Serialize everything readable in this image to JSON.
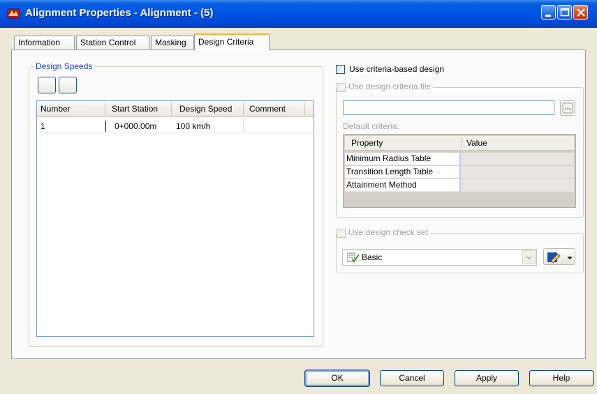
{
  "window": {
    "title": "Alignment Properties - Alignment - (5)",
    "titlebar_color": "#0055e5"
  },
  "tabs": [
    {
      "label": "Information"
    },
    {
      "label": "Station Control"
    },
    {
      "label": "Masking"
    },
    {
      "label": "Design Criteria",
      "active": true
    }
  ],
  "design_speeds": {
    "group_title": "Design Speeds",
    "columns": [
      "Number",
      "Start Station",
      "Design Speed",
      "Comment"
    ],
    "rows": [
      {
        "number": "1",
        "start_station": "0+000.00m",
        "design_speed": "100 km/h",
        "comment": ""
      }
    ]
  },
  "criteria": {
    "use_criteria_based_design_label": "Use criteria-based design",
    "use_criteria_based_design_checked": false,
    "use_design_criteria_file_label": "Use design criteria file",
    "file_path": "",
    "ellipsis_label": "...",
    "default_criteria_label": "Default criteria:",
    "property_columns": [
      "Property",
      "Value"
    ],
    "properties": [
      {
        "name": "Minimum Radius Table",
        "value": ""
      },
      {
        "name": "Transition Length Table",
        "value": ""
      },
      {
        "name": "Attainment Method",
        "value": ""
      }
    ],
    "use_design_check_set_label": "Use design check set",
    "check_set_selected": "Basic"
  },
  "buttons": {
    "ok": "OK",
    "cancel": "Cancel",
    "apply": "Apply",
    "help": "Help"
  },
  "icons": [
    "app-icon",
    "minimize-icon",
    "maximize-icon",
    "close-icon",
    "check-set-icon",
    "edit-icon",
    "dropdown-arrow-icon"
  ],
  "colors": {
    "group_title": "#1c3fa8",
    "disabled_text": "#a0a0a0",
    "window_bg": "#ece9d8"
  }
}
